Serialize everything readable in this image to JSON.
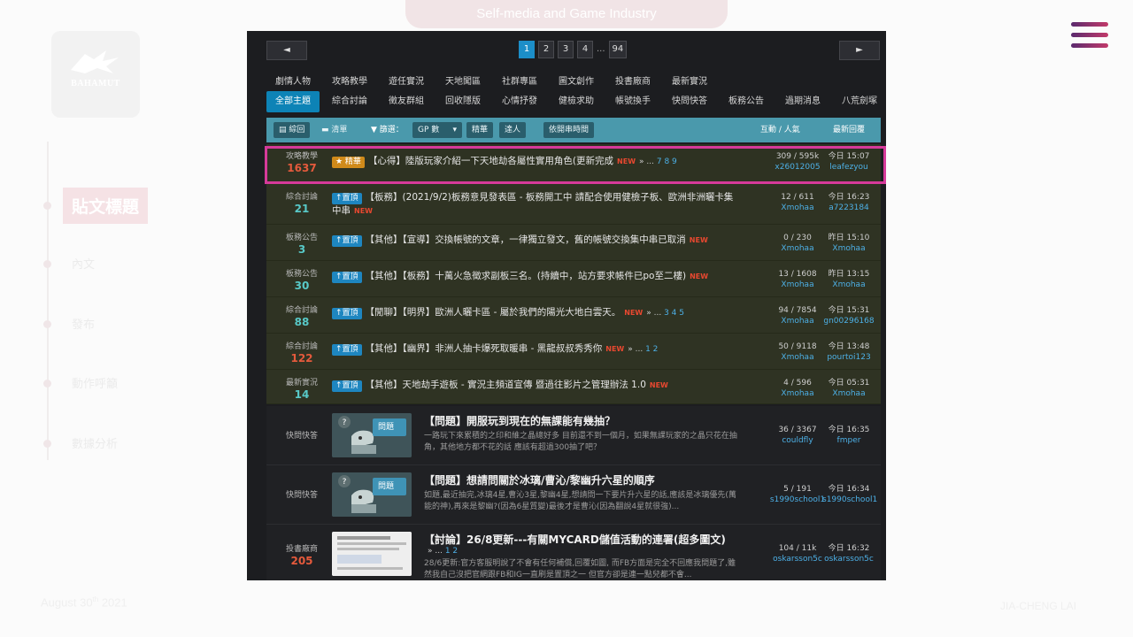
{
  "slide": {
    "header_text": "Self-media and Game Industry",
    "logo_text": "BAHAMUT",
    "timeline": [
      {
        "label": "貼文標題",
        "active": true
      },
      {
        "label": "內文",
        "active": false
      },
      {
        "label": "發布",
        "active": false
      },
      {
        "label": "動作呼籲",
        "active": false
      },
      {
        "label": "數據分析",
        "active": false
      }
    ],
    "date_main": "August 30",
    "date_sup": "th",
    "date_year": " 2021",
    "author": "JIA-CHENG LAI",
    "menu_icon": "hamburger-menu-icon",
    "accent_gradient": [
      "#5a2a6e",
      "#c23a6a"
    ],
    "highlight_color": "#d63a9a"
  },
  "forum": {
    "pager": {
      "prev": "◄",
      "next": "►",
      "pages": [
        "1",
        "2",
        "3",
        "4"
      ],
      "ellipsis": "...",
      "last": "94",
      "current": "1"
    },
    "cats_row1": [
      "劇情人物",
      "攻略教學",
      "遊任實況",
      "天地闖區",
      "社群專區",
      "圖文創作",
      "投書廠商",
      "最新實況"
    ],
    "cats_row2": [
      "全部主題",
      "綜合討論",
      "徵友群組",
      "回收隱版",
      "心情抒發",
      "健檢求助",
      "帳號換手",
      "快問快答",
      "板務公告",
      "過期消息",
      "八荒劍塚"
    ],
    "toolbar": {
      "view_summary": "綜回",
      "view_list": "清單",
      "filter_label": "篩選：",
      "sort_select": "GP 數",
      "btn_featured": "精華",
      "btn_expert": "達人",
      "btn_order": "依開串時間",
      "col_stats": "互動 / 人氣",
      "col_last": "最新回覆"
    },
    "pinned_rows": [
      {
        "cat": "攻略教學",
        "num": "1637",
        "num_color": "red",
        "badge": "★ 精華",
        "badge_type": "jh",
        "title": "【心得】陸版玩家介紹一下天地劫各屬性實用角色(更新完成",
        "new": "NEW",
        "pages_prefix": "» ...",
        "pages": "7  8  9",
        "stats": "309 / 595k",
        "author": "x26012005",
        "last_time": "今日 15:07",
        "last_user": "leafezyou"
      },
      {
        "cat": "綜合討論",
        "num": "21",
        "num_color": "teal",
        "badge": "↑置頂",
        "badge_type": "pin",
        "title": "【板務】(2021/9/2)板務意見發表區 - 板務開工中 請配合使用健檢子板、歐洲非洲曬卡集中串",
        "new": "NEW",
        "pages_prefix": "",
        "pages": "",
        "stats": "12 / 611",
        "author": "Xmohaa",
        "last_time": "今日 16:23",
        "last_user": "a7223184"
      },
      {
        "cat": "板務公告",
        "num": "3",
        "num_color": "teal",
        "badge": "↑置頂",
        "badge_type": "pin",
        "title": "【其他】【宣導】交換帳號的文章，一律獨立發文，舊的帳號交換集中串已取消",
        "new": "NEW",
        "pages_prefix": "",
        "pages": "",
        "stats": "0 / 230",
        "author": "Xmohaa",
        "last_time": "昨日 15:10",
        "last_user": "Xmohaa"
      },
      {
        "cat": "板務公告",
        "num": "30",
        "num_color": "teal",
        "badge": "↑置頂",
        "badge_type": "pin",
        "title": "【其他】【板務】十萬火急徵求副板三名。(持續中，站方要求帳件已po至二樓)",
        "new": "NEW",
        "pages_prefix": "",
        "pages": "",
        "stats": "13 / 1608",
        "author": "Xmohaa",
        "last_time": "昨日 13:15",
        "last_user": "Xmohaa"
      },
      {
        "cat": "綜合討論",
        "num": "88",
        "num_color": "teal",
        "badge": "↑置頂",
        "badge_type": "pin",
        "title": "【閒聊】【明界】歐洲人曬卡區 - 屬於我們的陽光大地白雲天。",
        "new": "NEW",
        "pages_prefix": "» ...",
        "pages": "3  4  5",
        "stats": "94 / 7854",
        "author": "Xmohaa",
        "last_time": "今日 15:31",
        "last_user": "gn00296168"
      },
      {
        "cat": "綜合討論",
        "num": "122",
        "num_color": "red",
        "badge": "↑置頂",
        "badge_type": "pin",
        "title": "【其他】【幽界】非洲人抽卡爆死取暖串 - 黑龍叔叔秀秀你",
        "new": "NEW",
        "pages_prefix": "» ...",
        "pages": "1  2",
        "stats": "50 / 9118",
        "author": "Xmohaa",
        "last_time": "今日 13:48",
        "last_user": "pourtoi123"
      },
      {
        "cat": "最新實況",
        "num": "14",
        "num_color": "teal",
        "badge": "↑置頂",
        "badge_type": "pin",
        "title": "【其他】天地劫手遊板 - 實況主頻道宣傳 暨過往影片之管理辦法 1.0",
        "new": "NEW",
        "pages_prefix": "",
        "pages": "",
        "stats": "4 / 596",
        "author": "Xmohaa",
        "last_time": "今日 05:31",
        "last_user": "Xmohaa"
      }
    ],
    "thumb_rows": [
      {
        "cat": "快問快答",
        "num": "",
        "thumb_type": "bubble",
        "thumb_label": "問題",
        "title": "【問題】開服玩到現在的無課能有幾抽？",
        "pages_prefix": "",
        "pages": "",
        "desc": "一路玩下來累積的之印和維之晶總好多 目前還不到一個月，如果無課玩家的之晶只花在抽角，其他地方都不花的話 應該有超過300抽了吧？",
        "stats": "36 / 3367",
        "author": "couldfly",
        "last_time": "今日 16:35",
        "last_user": "fmper"
      },
      {
        "cat": "快問快答",
        "num": "",
        "thumb_type": "bubble",
        "thumb_label": "問題",
        "title": "【問題】想請問關於冰璃/曹沁/黎幽升六星的順序",
        "pages_prefix": "",
        "pages": "",
        "desc": "如題,最近抽完,冰璃4星,曹沁3星,黎幽4星,想請問一下要片升六星的話,應該是冰璃優先(萬能的神),再來是黎幽?(因為6星質變)最後才是曹沁(因為翻說4星就很強)...",
        "stats": "5 / 191",
        "author": "s1990school1",
        "last_time": "今日 16:34",
        "last_user": "s1990school1"
      },
      {
        "cat": "投書廠商",
        "num": "205",
        "thumb_type": "doc",
        "thumb_label": "",
        "title": "【討論】26/8更新---有關MYCARD儲值活動的連署(超多圖文)",
        "pages_prefix": "» ...",
        "pages": "1  2",
        "desc": "28/6更新:官方客服明說了不會有任何補償,回覆如圖, 而FB方面是完全不回應我問題了,雖然我自己沒把官網跟FB和IG一直刷是置頂之一 但官方卻是連一點兒都不會...",
        "stats": "104 / 11k",
        "author": "oskarsson5c",
        "last_time": "今日 16:32",
        "last_user": "oskarsson5c"
      }
    ]
  }
}
